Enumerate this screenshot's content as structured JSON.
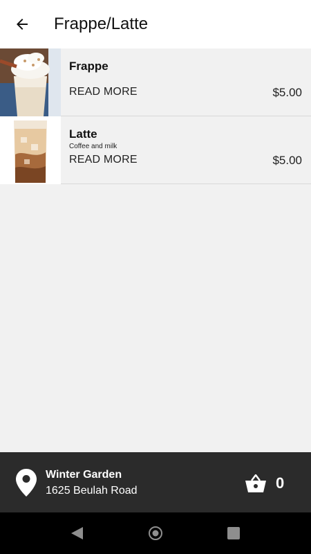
{
  "header": {
    "title": "Frappe/Latte",
    "back_icon": "arrow-left-icon"
  },
  "menu": {
    "items": [
      {
        "name": "Frappe",
        "description": "",
        "read_more": "READ MORE",
        "price": "$5.00",
        "image_icon": "frappe-photo"
      },
      {
        "name": "Latte",
        "description": "Coffee and milk",
        "read_more": "READ MORE",
        "price": "$5.00",
        "image_icon": "latte-photo"
      }
    ]
  },
  "location": {
    "name": "Winter Garden",
    "address": "1625 Beulah Road",
    "icon": "map-pin-icon"
  },
  "cart": {
    "count": "0",
    "icon": "basket-icon"
  },
  "system_nav": {
    "back_icon": "nav-back-icon",
    "home_icon": "nav-home-icon",
    "recents_icon": "nav-recents-icon"
  },
  "colors": {
    "app_bar": "#ffffff",
    "background": "#f1f1f1",
    "bottom_bar": "#2b2b2b",
    "system_nav": "#000000"
  }
}
